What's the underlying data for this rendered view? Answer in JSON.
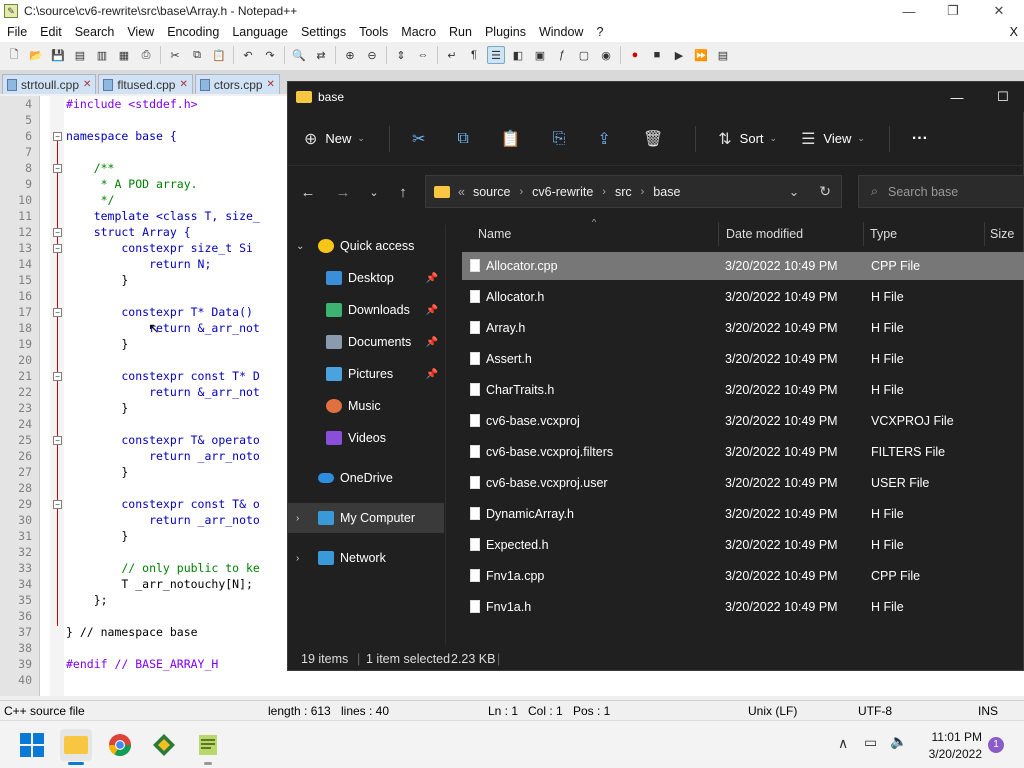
{
  "notepad": {
    "title": "C:\\source\\cv6-rewrite\\src\\base\\Array.h - Notepad++",
    "menu": [
      "File",
      "Edit",
      "Search",
      "View",
      "Encoding",
      "Language",
      "Settings",
      "Tools",
      "Macro",
      "Run",
      "Plugins",
      "Window",
      "?"
    ],
    "menu_close": "X",
    "tabs": [
      "strtoull.cpp",
      "fltused.cpp",
      "ctors.cpp"
    ],
    "code_lines": [
      {
        "n": "4",
        "t": "#include <stddef.h>"
      },
      {
        "n": "5",
        "t": ""
      },
      {
        "n": "6",
        "t": "namespace base {"
      },
      {
        "n": "7",
        "t": ""
      },
      {
        "n": "8",
        "t": "    /**"
      },
      {
        "n": "9",
        "t": "     * A POD array."
      },
      {
        "n": "10",
        "t": "     */"
      },
      {
        "n": "11",
        "t": "    template <class T, size_"
      },
      {
        "n": "12",
        "t": "    struct Array {"
      },
      {
        "n": "13",
        "t": "        constexpr size_t Si"
      },
      {
        "n": "14",
        "t": "            return N;"
      },
      {
        "n": "15",
        "t": "        }"
      },
      {
        "n": "16",
        "t": ""
      },
      {
        "n": "17",
        "t": "        constexpr T* Data()"
      },
      {
        "n": "18",
        "t": "            return &_arr_not"
      },
      {
        "n": "19",
        "t": "        }"
      },
      {
        "n": "20",
        "t": ""
      },
      {
        "n": "21",
        "t": "        constexpr const T* D"
      },
      {
        "n": "22",
        "t": "            return &_arr_not"
      },
      {
        "n": "23",
        "t": "        }"
      },
      {
        "n": "24",
        "t": ""
      },
      {
        "n": "25",
        "t": "        constexpr T& operato"
      },
      {
        "n": "26",
        "t": "            return _arr_noto"
      },
      {
        "n": "27",
        "t": "        }"
      },
      {
        "n": "28",
        "t": ""
      },
      {
        "n": "29",
        "t": "        constexpr const T& o"
      },
      {
        "n": "30",
        "t": "            return _arr_noto"
      },
      {
        "n": "31",
        "t": "        }"
      },
      {
        "n": "32",
        "t": ""
      },
      {
        "n": "33",
        "t": "        // only public to ke"
      },
      {
        "n": "34",
        "t": "        T _arr_notouchy[N];"
      },
      {
        "n": "35",
        "t": "    };"
      },
      {
        "n": "36",
        "t": ""
      },
      {
        "n": "37",
        "t": "} // namespace base"
      },
      {
        "n": "38",
        "t": ""
      },
      {
        "n": "39",
        "t": "#endif // BASE_ARRAY_H"
      },
      {
        "n": "40",
        "t": ""
      }
    ],
    "status": {
      "lang": "C++ source file",
      "length": "length : 613",
      "lines": "lines : 40",
      "ln": "Ln : 1",
      "col": "Col : 1",
      "pos": "Pos : 1",
      "eol": "Unix (LF)",
      "enc": "UTF-8",
      "ins": "INS"
    }
  },
  "explorer": {
    "title": "base",
    "commands": {
      "new": "New",
      "sort": "Sort",
      "view": "View",
      "more": "···"
    },
    "address": [
      "source",
      "cv6-rewrite",
      "src",
      "base"
    ],
    "address_prefix": "«",
    "search_placeholder": "Search base",
    "nav": [
      {
        "label": "Quick access",
        "color": "#f5c518",
        "pinned": false
      },
      {
        "label": "Desktop",
        "color": "#3b8fd9",
        "pinned": true
      },
      {
        "label": "Downloads",
        "color": "#3cb371",
        "pinned": true
      },
      {
        "label": "Documents",
        "color": "#8a9bb0",
        "pinned": true
      },
      {
        "label": "Pictures",
        "color": "#4aa3df",
        "pinned": true
      },
      {
        "label": "Music",
        "color": "#e07040",
        "pinned": false
      },
      {
        "label": "Videos",
        "color": "#8a4fd8",
        "pinned": false
      },
      {
        "label": "OneDrive",
        "color": "#2d8ee0",
        "pinned": false
      },
      {
        "label": "My Computer",
        "color": "#3a9ad9",
        "pinned": false
      },
      {
        "label": "Network",
        "color": "#3a9ad9",
        "pinned": false
      }
    ],
    "columns": {
      "name": "Name",
      "date": "Date modified",
      "type": "Type",
      "size": "Size"
    },
    "files": [
      {
        "name": "Allocator.cpp",
        "date": "3/20/2022 10:49 PM",
        "type": "CPP File"
      },
      {
        "name": "Allocator.h",
        "date": "3/20/2022 10:49 PM",
        "type": "H File"
      },
      {
        "name": "Array.h",
        "date": "3/20/2022 10:49 PM",
        "type": "H File"
      },
      {
        "name": "Assert.h",
        "date": "3/20/2022 10:49 PM",
        "type": "H File"
      },
      {
        "name": "CharTraits.h",
        "date": "3/20/2022 10:49 PM",
        "type": "H File"
      },
      {
        "name": "cv6-base.vcxproj",
        "date": "3/20/2022 10:49 PM",
        "type": "VCXPROJ File"
      },
      {
        "name": "cv6-base.vcxproj.filters",
        "date": "3/20/2022 10:49 PM",
        "type": "FILTERS File"
      },
      {
        "name": "cv6-base.vcxproj.user",
        "date": "3/20/2022 10:49 PM",
        "type": "USER File"
      },
      {
        "name": "DynamicArray.h",
        "date": "3/20/2022 10:49 PM",
        "type": "H File"
      },
      {
        "name": "Expected.h",
        "date": "3/20/2022 10:49 PM",
        "type": "H File"
      },
      {
        "name": "Fnv1a.cpp",
        "date": "3/20/2022 10:49 PM",
        "type": "CPP File"
      },
      {
        "name": "Fnv1a.h",
        "date": "3/20/2022 10:49 PM",
        "type": "H File"
      }
    ],
    "status": {
      "count": "19 items",
      "selected": "1 item selected",
      "size": "2.23 KB"
    }
  },
  "taskbar": {
    "time": "11:01 PM",
    "date": "3/20/2022",
    "notification_count": "1"
  }
}
